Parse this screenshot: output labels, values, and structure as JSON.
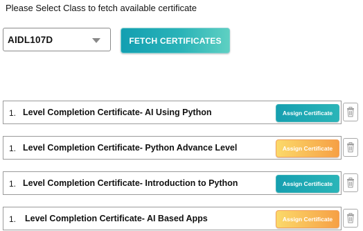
{
  "prompt": "Please Select Class to fetch available certificate",
  "class_select": {
    "value": "AIDL107D"
  },
  "fetch_button": {
    "label": "FETCH CERTIFICATES"
  },
  "certificates": [
    {
      "number": "1.",
      "title": "Level Completion Certificate- AI Using Python",
      "assign_label": "Assign Certificate",
      "assign_color": "teal"
    },
    {
      "number": "1.",
      "title": "Level Completion Certificate- Python Advance Level",
      "assign_label": "Assign Certificate",
      "assign_color": "yellow"
    },
    {
      "number": "1.",
      "title": "Level Completion Certificate- Introduction to Python",
      "assign_label": "Assign Certificate",
      "assign_color": "teal"
    },
    {
      "number": "1.",
      "title": "Level Completion Certificate- AI Based Apps",
      "assign_label": "Assign Certificate",
      "assign_color": "yellow"
    }
  ],
  "colors": {
    "teal": "#1aa6b3",
    "yellow": "#f8c35a",
    "delete_icon": "#9a9a9a"
  },
  "icons": {
    "delete": "trash-icon",
    "dropdown": "chevron-down-icon"
  }
}
